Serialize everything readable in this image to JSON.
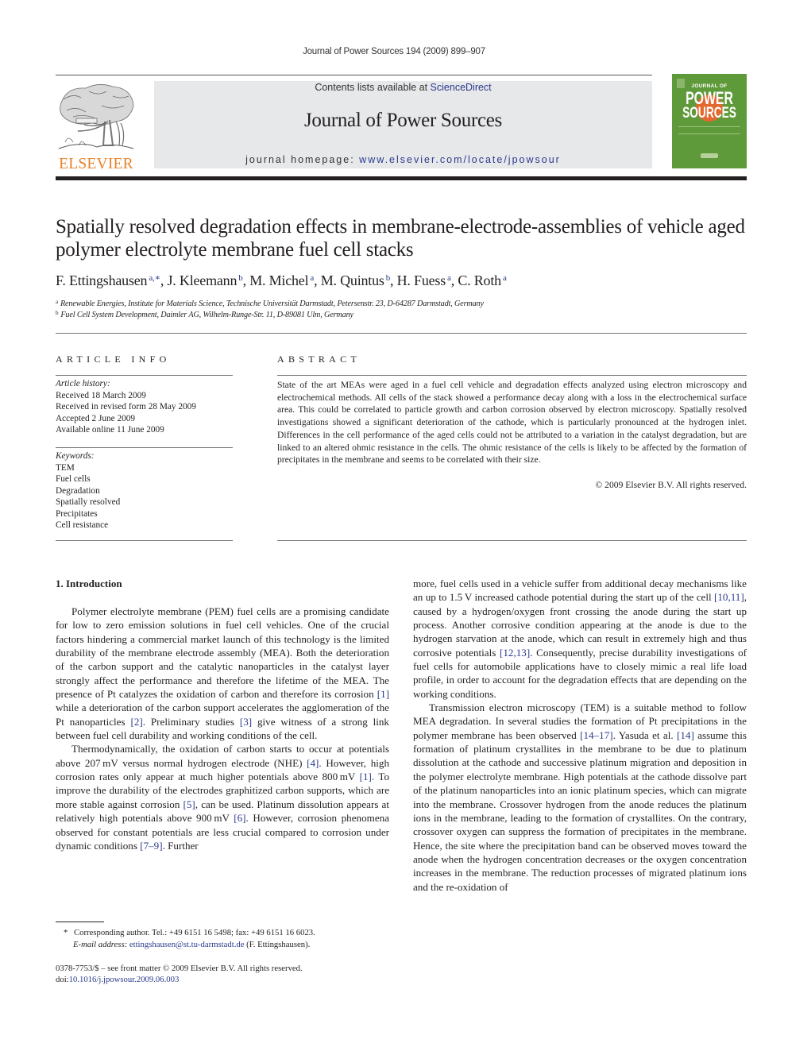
{
  "running_head": "Journal of Power Sources 194 (2009) 899–907",
  "publisher": {
    "logo_word": "ELSEVIER",
    "logo_color": "#e8822a"
  },
  "banner": {
    "contents_prefix": "Contents lists available at ",
    "contents_link": "ScienceDirect",
    "journal_title": "Journal of Power Sources",
    "homepage_prefix": "journal homepage: ",
    "homepage_link": "www.elsevier.com/locate/jpowsour"
  },
  "cover": {
    "journal_of": "JOURNAL OF",
    "line1": "POWER",
    "line2": "SOURCES",
    "color": "#5f9a3a"
  },
  "article": {
    "title": "Spatially resolved degradation effects in membrane-electrode-assemblies of vehicle aged polymer electrolyte membrane fuel cell stacks",
    "authors": [
      {
        "name": "F. Ettingshausen",
        "aff": "a,∗"
      },
      {
        "name": "J. Kleemann",
        "aff": "b"
      },
      {
        "name": "M. Michel",
        "aff": "a"
      },
      {
        "name": "M. Quintus",
        "aff": "b"
      },
      {
        "name": "H. Fuess",
        "aff": "a"
      },
      {
        "name": "C. Roth",
        "aff": "a"
      }
    ],
    "affiliations": [
      {
        "mark": "a",
        "text": "Renewable Energies, Institute for Materials Science, Technische Universität Darmstadt, Petersenstr. 23, D-64287 Darmstadt, Germany"
      },
      {
        "mark": "b",
        "text": "Fuel Cell System Development, Daimler AG, Wilhelm-Runge-Str. 11, D-89081 Ulm, Germany"
      }
    ]
  },
  "article_info": {
    "heading": "ARTICLE INFO",
    "history_label": "Article history:",
    "history": [
      "Received 18 March 2009",
      "Received in revised form 28 May 2009",
      "Accepted 2 June 2009",
      "Available online 11 June 2009"
    ],
    "keywords_label": "Keywords:",
    "keywords": [
      "TEM",
      "Fuel cells",
      "Degradation",
      "Spatially resolved",
      "Precipitates",
      "Cell resistance"
    ]
  },
  "abstract": {
    "heading": "ABSTRACT",
    "text": "State of the art MEAs were aged in a fuel cell vehicle and degradation effects analyzed using electron microscopy and electrochemical methods. All cells of the stack showed a performance decay along with a loss in the electrochemical surface area. This could be correlated to particle growth and carbon corrosion observed by electron microscopy. Spatially resolved investigations showed a significant deterioration of the cathode, which is particularly pronounced at the hydrogen inlet. Differences in the cell performance of the aged cells could not be attributed to a variation in the catalyst degradation, but are linked to an altered ohmic resistance in the cells. The ohmic resistance of the cells is likely to be affected by the formation of precipitates in the membrane and seems to be correlated with their size.",
    "copyright": "© 2009 Elsevier B.V. All rights reserved."
  },
  "body": {
    "section_heading": "1.  Introduction",
    "left_paragraphs": [
      [
        {
          "t": "Polymer electrolyte membrane (PEM) fuel cells are a promising candidate for low to zero emission solutions in fuel cell vehicles. One of the crucial factors hindering a commercial market launch of this technology is the limited durability of the membrane electrode assembly (MEA). Both the deterioration of the carbon support and the catalytic nanoparticles in the catalyst layer strongly affect the performance and therefore the lifetime of the MEA. The presence of Pt catalyzes the oxidation of carbon and therefore its corrosion "
        },
        {
          "ref": "[1]"
        },
        {
          "t": " while a deterioration of the carbon support accelerates the agglom­eration of the Pt nanoparticles "
        },
        {
          "ref": "[2]"
        },
        {
          "t": ". Preliminary studies "
        },
        {
          "ref": "[3]"
        },
        {
          "t": " give witness of a strong link between fuel cell durability and working conditions of the cell."
        }
      ],
      [
        {
          "t": "Thermodynamically, the oxidation of carbon starts to occur at potentials above 207 mV versus normal hydrogen electrode (NHE) "
        },
        {
          "ref": "[4]"
        },
        {
          "t": ". However, high corrosion rates only appear at much higher potentials above 800 mV "
        },
        {
          "ref": "[1]"
        },
        {
          "t": ". To improve the durability of the electrodes graphitized carbon supports, which are more stable against corrosion "
        },
        {
          "ref": "[5]"
        },
        {
          "t": ", can be used. Platinum dissolution appears at relatively high potentials above 900 mV "
        },
        {
          "ref": "[6]"
        },
        {
          "t": ". However, corro­sion phenomena observed for constant potentials are less crucial compared to corrosion under dynamic conditions "
        },
        {
          "ref": "[7–9]"
        },
        {
          "t": ". Further­"
        }
      ]
    ],
    "right_paragraphs": [
      [
        {
          "t": "more, fuel cells used in a vehicle suffer from additional decay mechanisms like an up to 1.5 V increased cathode potential dur­ing the start up of the cell "
        },
        {
          "ref": "[10,11]"
        },
        {
          "t": ", caused by a hydrogen/oxygen front crossing the anode during the start up process. Another cor­rosive condition appearing at the anode is due to the hydrogen starvation at the anode, which can result in extremely high and thus corrosive potentials "
        },
        {
          "ref": "[12,13]"
        },
        {
          "t": ". Consequently, precise durabil­ity investigations of fuel cells for automobile applications have to closely mimic a real life load profile, in order to account for the degradation effects that are depending on the working con­ditions."
        }
      ],
      [
        {
          "t": "Transmission electron microscopy (TEM) is a suitable method to follow MEA degradation. In several studies the formation of Pt pre­cipitations in the polymer membrane has been observed "
        },
        {
          "ref": "[14–17]"
        },
        {
          "t": ". Yasuda et al. "
        },
        {
          "ref": "[14]"
        },
        {
          "t": " assume this formation of platinum crystallites in the membrane to be due to platinum dissolution at the cathode and successive platinum migration and deposition in the poly­mer electrolyte membrane. High potentials at the cathode dissolve part of the platinum nanoparticles into an ionic platinum species, which can migrate into the membrane. Crossover hydrogen from the anode reduces the platinum ions in the membrane, leading to the formation of crystallites. On the contrary, crossover oxy­gen can suppress the formation of precipitates in the membrane. Hence, the site where the precipitation band can be observed moves toward the anode when the hydrogen concentration decreases or the oxygen concentration increases in the membrane. The reduc­tion processes of migrated platinum ions and the re-oxidation of"
        }
      ]
    ]
  },
  "footnotes": {
    "star": "*",
    "corresponding": "Corresponding author. Tel.: +49 6151 16 5498; fax: +49 6151 16 6023.",
    "email_label": "E-mail address:",
    "email": "ettingshausen@st.tu-darmstadt.de",
    "email_suffix": " (F. Ettingshausen).",
    "issn_line": "0378-7753/$ – see front matter © 2009 Elsevier B.V. All rights reserved.",
    "doi_label": "doi:",
    "doi": "10.1016/j.jpowsour.2009.06.003"
  }
}
